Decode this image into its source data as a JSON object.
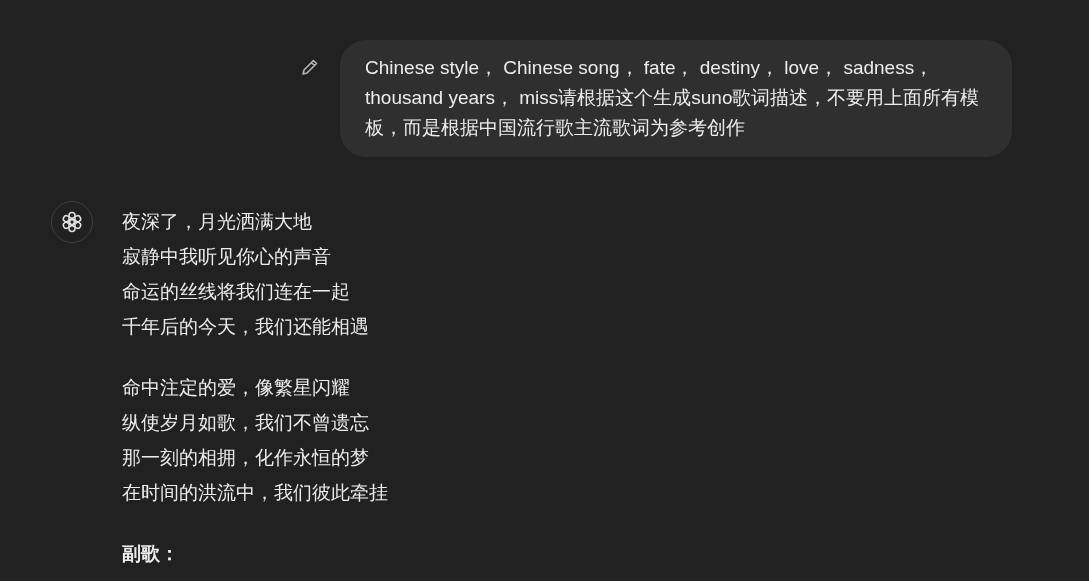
{
  "user_message": {
    "text": "Chinese style， Chinese song， fate， destiny， love， sadness， thousand years， miss请根据这个生成suno歌词描述，不要用上面所有模板，而是根据中国流行歌主流歌词为参考创作"
  },
  "assistant_message": {
    "blocks": [
      {
        "kind": "verse",
        "lines": [
          "夜深了，月光洒满大地",
          "寂静中我听见你心的声音",
          "命运的丝线将我们连在一起",
          "千年后的今天，我们还能相遇"
        ]
      },
      {
        "kind": "verse",
        "lines": [
          "命中注定的爱，像繁星闪耀",
          "纵使岁月如歌，我们不曾遗忘",
          "那一刻的相拥，化作永恒的梦",
          "在时间的洪流中，我们彼此牵挂"
        ]
      },
      {
        "kind": "heading",
        "text": "副歌："
      }
    ]
  }
}
